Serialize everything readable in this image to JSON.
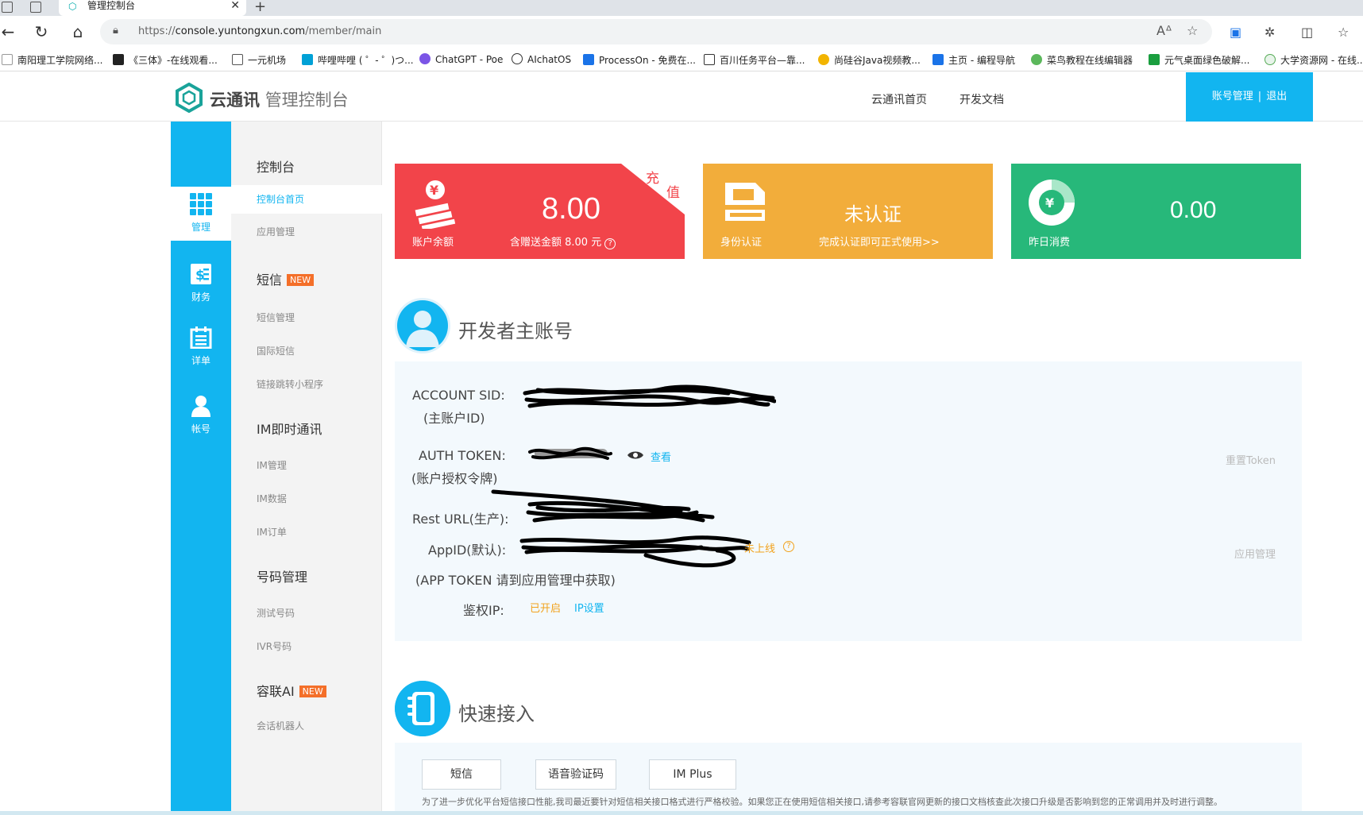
{
  "browser": {
    "tab_title": "管理控制台",
    "url_prefix": "https://",
    "url_host": "console.yuntongxun.com",
    "url_path": "/member/main",
    "bookmarks": [
      "南阳理工学院网络...",
      "《三体》-在线观看...",
      "一元机场",
      "哔哩哔哩 ( ゜- ゜)つ...",
      "ChatGPT - Poe",
      "AIchatOS",
      "ProcessOn - 免费在...",
      "百川任务平台—靠...",
      "尚硅谷Java视频教...",
      "主页 - 编程导航",
      "菜鸟教程在线编辑器",
      "元气桌面绿色破解...",
      "大学资源网 - 在线..."
    ]
  },
  "header": {
    "brand": "云通讯",
    "brand_sub": "管理控制台",
    "nav": [
      "云通讯首页",
      "开发文档"
    ],
    "account_manage": "账号管理",
    "separator": "|",
    "logout": "退出"
  },
  "rail": [
    {
      "label": "管理",
      "icon": "grid-icon"
    },
    {
      "label": "财务",
      "icon": "finance-icon"
    },
    {
      "label": "详单",
      "icon": "calendar-icon"
    },
    {
      "label": "帐号",
      "icon": "user-icon"
    }
  ],
  "submenu": {
    "console": "控制台",
    "console_home": "控制台首页",
    "app_manage": "应用管理",
    "sms": "短信",
    "sms_manage": "短信管理",
    "intl_sms": "国际短信",
    "link_jump": "链接跳转小程序",
    "im": "IM即时通讯",
    "im_manage": "IM管理",
    "im_data": "IM数据",
    "im_order": "IM订单",
    "number_manage": "号码管理",
    "test_number": "测试号码",
    "ivr_number": "IVR号码",
    "ronglian_ai": "容联AI",
    "chatbot": "会话机器人",
    "new_badge": "NEW"
  },
  "cards": {
    "balance": {
      "label": "账户余额",
      "value": "8.00",
      "sub": "含赠送金额 8.00 元",
      "help": "?",
      "corner_1": "充",
      "corner_2": "值"
    },
    "identity": {
      "label": "身份认证",
      "value": "未认证",
      "sub": "完成认证即可正式使用>>"
    },
    "yesterday": {
      "label": "昨日消费",
      "value": "0.00"
    },
    "colors": {
      "red": "#f2444a",
      "orange": "#f2ad3b",
      "green": "#27b87a",
      "accent": "#12b5f0"
    }
  },
  "developer": {
    "title": "开发者主账号",
    "account_sid_label": "ACCOUNT SID:",
    "account_sid_sub": "(主账户ID)",
    "auth_token_label": "AUTH TOKEN:",
    "auth_token_sub": "(账户授权令牌)",
    "view": "查看",
    "reset_token": "重置Token",
    "rest_url_label": "Rest URL(生产):",
    "appid_label": "AppID(默认):",
    "appid_status": "未上线",
    "app_manage": "应用管理",
    "app_token_note": "(APP TOKEN 请到应用管理中获取)",
    "auth_ip_label": "鉴权IP:",
    "auth_ip_status": "已开启",
    "ip_settings": "IP设置"
  },
  "quick": {
    "title": "快速接入",
    "buttons": [
      "短信",
      "语音验证码",
      "IM Plus"
    ],
    "note": "为了进一步优化平台短信接口性能,我司最近要针对短信相关接口格式进行严格校验。如果您正在使用短信相关接口,请参考容联官网更新的接口文档核查此次接口升级是否影响到您的正常调用并及时进行调整。"
  }
}
